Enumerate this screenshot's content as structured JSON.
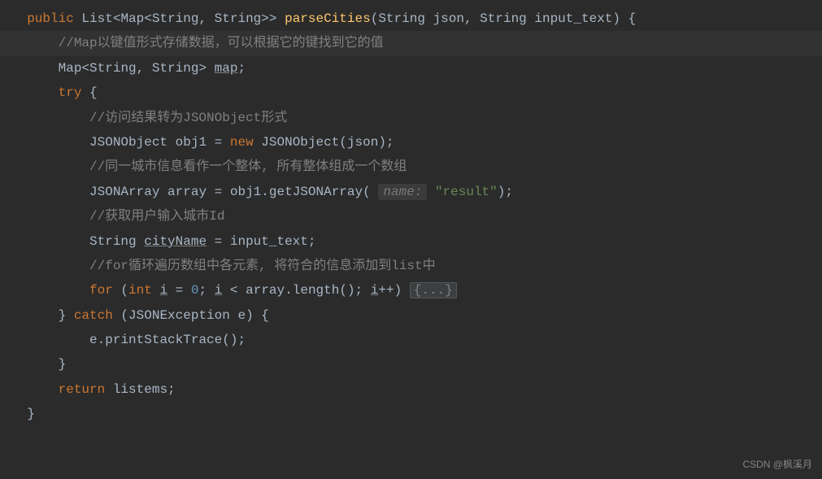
{
  "code": {
    "line1": {
      "public": "public",
      "type1": "List",
      "type2": "Map",
      "type3": "String",
      "type4": "String",
      "method": "parseCities",
      "paramType1": "String",
      "paramName1": "json",
      "paramType2": "String",
      "paramName2": "input_text"
    },
    "line2": {
      "comment": "//Map以键值形式存储数据，可以根据它的键找到它的值"
    },
    "line3": {
      "type1": "Map",
      "type2": "String",
      "type3": "String",
      "var": "map"
    },
    "line4": {
      "try": "try"
    },
    "line5": {
      "comment": "//访问结果转为JSONObject形式"
    },
    "line6": {
      "type": "JSONObject",
      "var": "obj1",
      "new": "new",
      "ctor": "JSONObject",
      "arg": "json"
    },
    "line7": {
      "comment": "//同一城市信息看作一个整体, 所有整体组成一个数组"
    },
    "line8": {
      "type": "JSONArray",
      "var": "array",
      "obj": "obj1",
      "method": "getJSONArray",
      "hint": "name:",
      "str": "\"result\""
    },
    "line9": {
      "comment": "//获取用户输入城市Id"
    },
    "line10": {
      "type": "String",
      "var": "cityName",
      "rhs": "input_text"
    },
    "line11": {
      "comment": "//for循环遍历数组中各元素, 将符合的信息添加到list中"
    },
    "line12": {
      "for": "for",
      "int": "int",
      "i": "i",
      "zero": "0",
      "lt_i": "i",
      "array": "array",
      "length": "length",
      "inc_i": "i",
      "fold": "{...}"
    },
    "line13": {
      "catch": "catch",
      "type": "JSONException",
      "var": "e"
    },
    "line14": {
      "obj": "e",
      "method": "printStackTrace"
    },
    "line15": {
      "return": "return",
      "var": "listems"
    }
  },
  "watermark": "CSDN @枫溪月"
}
